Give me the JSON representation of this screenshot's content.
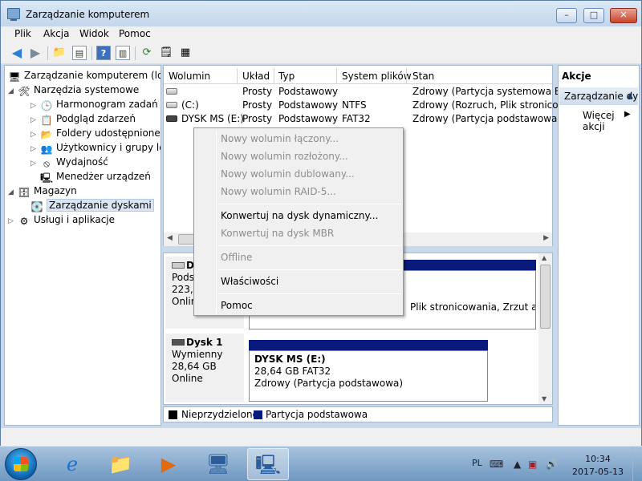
{
  "window": {
    "title": "Zarządzanie komputerem",
    "buttons": {
      "minimize": "–",
      "maximize": "□",
      "close": "✕"
    }
  },
  "menu": [
    "Plik",
    "Akcja",
    "Widok",
    "Pomoc"
  ],
  "tree": {
    "root": "Zarządzanie komputerem (lokalny)",
    "system_tools": "Narzędzia systemowe",
    "task_scheduler": "Harmonogram zadań",
    "event_viewer": "Podgląd zdarzeń",
    "shared_folders": "Foldery udostępnione",
    "users_groups": "Użytkownicy i grupy lokalne",
    "performance": "Wydajność",
    "device_manager": "Menedżer urządzeń",
    "storage": "Magazyn",
    "disk_management": "Zarządzanie dyskami",
    "services": "Usługi i aplikacje"
  },
  "volumes": {
    "headers": [
      "Wolumin",
      "Układ",
      "Typ",
      "System plików",
      "Stan"
    ],
    "rows": [
      {
        "name": "",
        "layout": "Prosty",
        "type": "Podstawowy",
        "fs": "",
        "status": "Zdrowy (Partycja systemowa EFI)"
      },
      {
        "name": "(C:)",
        "layout": "Prosty",
        "type": "Podstawowy",
        "fs": "NTFS",
        "status": "Zdrowy (Rozruch, Plik stronicowania"
      },
      {
        "name": "DYSK MS (E:)",
        "layout": "Prosty",
        "type": "Podstawowy",
        "fs": "FAT32",
        "status": "Zdrowy (Partycja podstawowa)"
      }
    ]
  },
  "disk0": {
    "name": "Dysk 0",
    "type": "Podst",
    "size": "223,4",
    "state": "Onlin",
    "partition_fragment": "Plik stronicowania, Zrzut awa"
  },
  "disk1": {
    "name": "Dysk 1",
    "type": "Wymienny",
    "size": "28,64 GB",
    "state": "Online",
    "partition": {
      "label": "DYSK MS  (E:)",
      "size_fs": "28,64 GB FAT32",
      "status": "Zdrowy (Partycja podstawowa)"
    }
  },
  "legend": [
    {
      "label": "Nieprzydzielone",
      "color": "#000000"
    },
    {
      "label": "Partycja podstawowa",
      "color": "#0a1a7c"
    }
  ],
  "actions": {
    "header": "Akcje",
    "sub": "Zarządzanie dyskami",
    "more": "Więcej akcji"
  },
  "context_menu": {
    "new_spanned_join": "Nowy wolumin łączony...",
    "new_striped": "Nowy wolumin rozłożony...",
    "new_mirrored": "Nowy wolumin dublowany...",
    "new_raid5": "Nowy wolumin RAID-5...",
    "convert_dynamic": "Konwertuj na dysk dynamiczny...",
    "convert_mbr": "Konwertuj na dysk MBR",
    "offline": "Offline",
    "properties": "Właściwości",
    "help": "Pomoc"
  },
  "taskbar": {
    "lang": "PL",
    "time": "10:34",
    "date": "2017-05-13"
  }
}
